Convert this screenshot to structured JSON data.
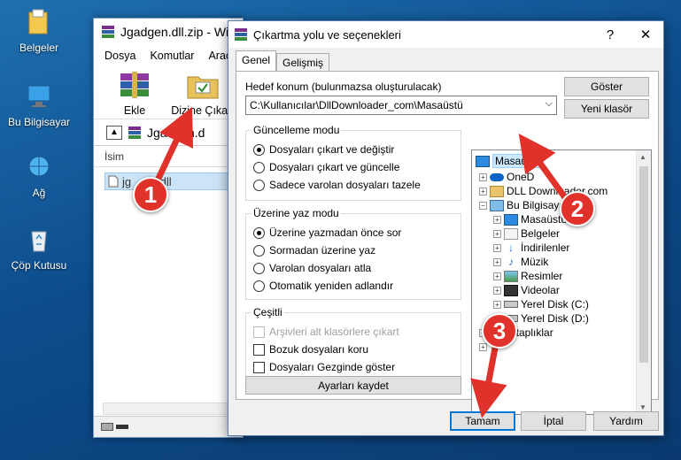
{
  "desktop": {
    "icons": [
      {
        "label": "Belgeler"
      },
      {
        "label": "Bu Bilgisayar"
      },
      {
        "label": "Ağ"
      },
      {
        "label": "Çöp Kutusu"
      }
    ]
  },
  "winrar": {
    "title": "Jgadgen.dll.zip - Wi",
    "menu": [
      "Dosya",
      "Komutlar",
      "Araçla"
    ],
    "toolbar": {
      "add": "Ekle",
      "extract": "Dizine Çıkart"
    },
    "path": "Jgadgen.d",
    "list_header": "İsim",
    "file": "jg      n.dll"
  },
  "dialog": {
    "title": "Çıkartma yolu ve seçenekleri",
    "help": "?",
    "close": "✕",
    "tabs": [
      "Genel",
      "Gelişmiş"
    ],
    "dest_label": "Hedef konum (bulunmazsa oluşturulacak)",
    "dest_value": "C:\\Kullanıcılar\\DllDownloader_com\\Masaüstü",
    "show_button": "Göster",
    "new_folder_button": "Yeni klasör",
    "update_mode": {
      "title": "Güncelleme modu",
      "options": [
        "Dosyaları çıkart ve değiştir",
        "Dosyaları çıkart ve güncelle",
        "Sadece varolan dosyaları tazele"
      ]
    },
    "overwrite_mode": {
      "title": "Üzerine yaz modu",
      "options": [
        "Üzerine yazmadan önce sor",
        "Sormadan üzerine yaz",
        "Varolan dosyaları atla",
        "Otomatik yeniden adlandır"
      ]
    },
    "misc": {
      "title": "Çeşitli",
      "options": [
        "Arşivleri alt klasörlere çıkart",
        "Bozuk dosyaları koru",
        "Dosyaları Gezginde göster"
      ]
    },
    "save_settings": "Ayarları kaydet",
    "tree": [
      "Masaüstü",
      "OneD",
      "DLL Downloader.com",
      "Bu Bilgisaya",
      "Masaüstü",
      "Belgeler",
      "İndirilenler",
      "Müzik",
      "Resimler",
      "Videolar",
      "Yerel Disk (C:)",
      "Yerel Disk (D:)",
      "Kitaplıklar"
    ],
    "ok": "Tamam",
    "cancel": "İptal",
    "help_button": "Yardım"
  },
  "annotations": [
    "1",
    "2",
    "3"
  ],
  "colors": {
    "arrow": "#e0322a",
    "selection": "#cce8ff",
    "accent": "#0078d7"
  }
}
